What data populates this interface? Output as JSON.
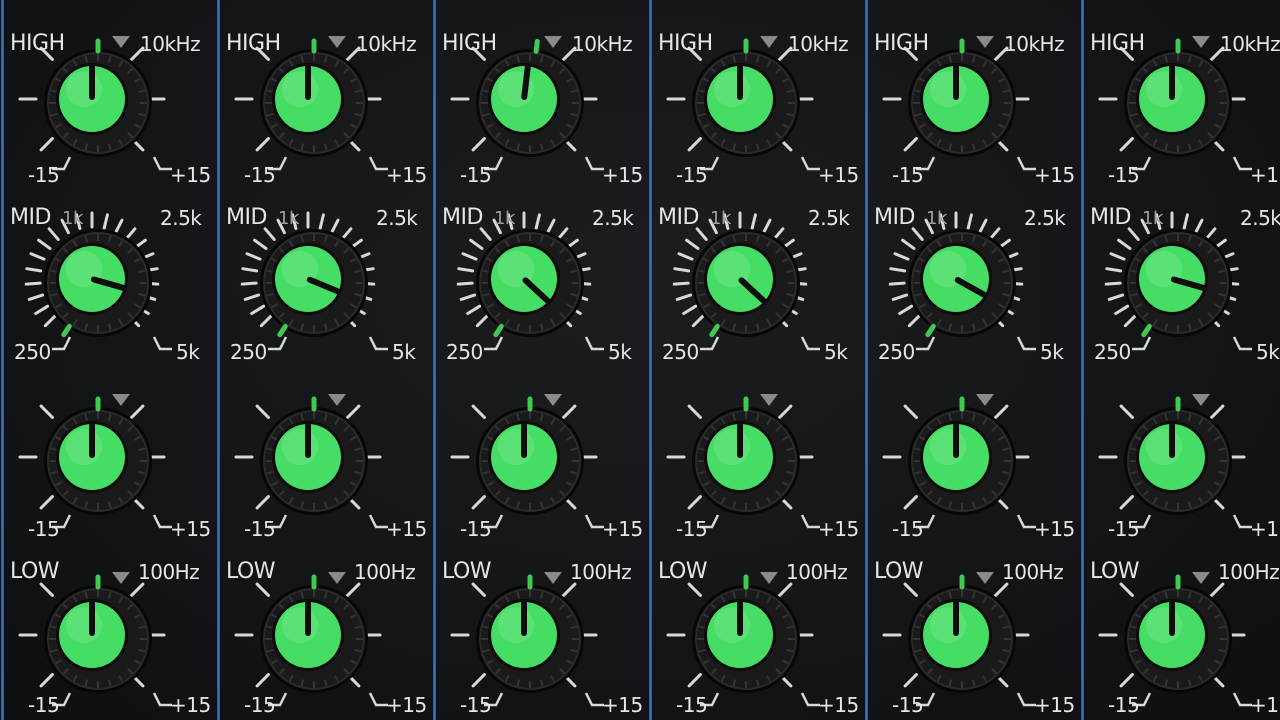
{
  "colors": {
    "panel": "#141516",
    "divider": "#2f6fd0",
    "cap": "#46dd64",
    "indicator": "#3fca52",
    "tick": "#d8d8d8",
    "center_marker": "#8a8a8a"
  },
  "channels": [
    {
      "high": 0,
      "mid_gain": -0.55,
      "mid_freq": 0.05,
      "low": 0
    },
    {
      "high": 0,
      "mid_gain": -0.5,
      "mid_freq": 0.05,
      "low": 0
    },
    {
      "high": 0.05,
      "mid_gain": -0.35,
      "mid_freq": 0.05,
      "low": 0
    },
    {
      "high": 0,
      "mid_gain": -0.35,
      "mid_freq": 0.05,
      "low": 0
    },
    {
      "high": 0,
      "mid_gain": -0.45,
      "mid_freq": 0.05,
      "low": 0
    },
    {
      "high": 0,
      "mid_gain": -0.55,
      "mid_freq": 0.05,
      "low": 0
    }
  ],
  "labels": {
    "high": "HIGH",
    "high_freq": "10kHz",
    "mid": "MID",
    "mid_1k": "1k",
    "mid_2_5k": "2.5k",
    "mid_250": "250",
    "mid_5k": "5k",
    "low": "LOW",
    "low_freq": "100Hz",
    "minus": "-15",
    "plus": "+15"
  }
}
